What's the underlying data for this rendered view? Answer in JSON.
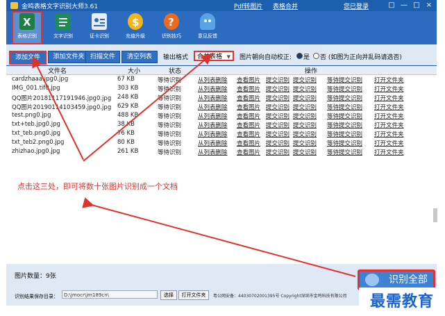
{
  "window": {
    "title": "金鸣表格文字识别大师3.61",
    "links": {
      "pdf": "Pdf转图片",
      "merge": "表格合并",
      "login": "您已登录"
    },
    "controls": [
      "□",
      "—",
      "□",
      "×"
    ]
  },
  "toolbar": {
    "items": [
      {
        "label": "表格识别",
        "icon": "excel-icon"
      },
      {
        "label": "文字识别",
        "icon": "document-icon"
      },
      {
        "label": "证卡识别",
        "icon": "id-card-icon"
      },
      {
        "label": "充值升级",
        "icon": "coin-icon"
      },
      {
        "label": "识别技巧",
        "icon": "help-icon"
      },
      {
        "label": "意见反馈",
        "icon": "feedback-icon"
      }
    ]
  },
  "actions": {
    "add_file": "添加文件",
    "add_folder": "添加文件夹",
    "scan_file": "扫描文件",
    "clear_list": "清空列表",
    "output_format_label": "输出格式",
    "output_format_value": "合并表格",
    "orientation_label": "图片朝向自动校正:",
    "yes": "是",
    "no": "否 (如图为正向并乱码请选否)"
  },
  "table": {
    "headers": {
      "filename": "文件名",
      "size": "大小",
      "status": "状态",
      "ops": "操作"
    },
    "rows": [
      {
        "name": "cardzhaaa.jpg0.jpg",
        "size": "67 KB",
        "status": "等待识别"
      },
      {
        "name": "IMG_001.tif0.jpg",
        "size": "303 KB",
        "status": "等待识别"
      },
      {
        "name": "QQ图片20181117191946.jpg0.jpg",
        "size": "248 KB",
        "status": "等待识别"
      },
      {
        "name": "QQ图片20190114103459.jpg0.jpg",
        "size": "629 KB",
        "status": "等待识别"
      },
      {
        "name": "test.png0.jpg",
        "size": "488 KB",
        "status": "等待识别"
      },
      {
        "name": "txt+teb.jpg0.jpg",
        "size": "38 KB",
        "status": "等待识别"
      },
      {
        "name": "txt_teb.png0.jpg",
        "size": "76 KB",
        "status": "等待识别"
      },
      {
        "name": "txt_teb2.png0.jpg",
        "size": "80 KB",
        "status": "等待识别"
      },
      {
        "name": "zhizhao.jpg0.jpg",
        "size": "261 KB",
        "status": "等待识别"
      }
    ],
    "row_actions": [
      "从列表删除",
      "查看图片",
      "提交识别",
      "提交识别",
      "等待提交识别",
      "打开文件夹"
    ]
  },
  "annotation": "点击这三处，即可将数十张图片识别成一个文档",
  "status": {
    "count": "图片数量：9张",
    "save_label": "识别结果保存目录：",
    "save_path": "D:\\jmocr\\jm189cn\\",
    "choose_btn": "选择",
    "open_folder_btn": "打开文件夹",
    "registration": "粤公网安备：44030702001395号   Copyright深圳市金鸣科技有限公司",
    "recognize_all": "识别全部"
  },
  "watermark": "最需教育",
  "colors": {
    "accent": "#2c6cc0",
    "highlight": "#e03232",
    "annotation": "#e0322d",
    "watermark": "#1b63d1"
  }
}
